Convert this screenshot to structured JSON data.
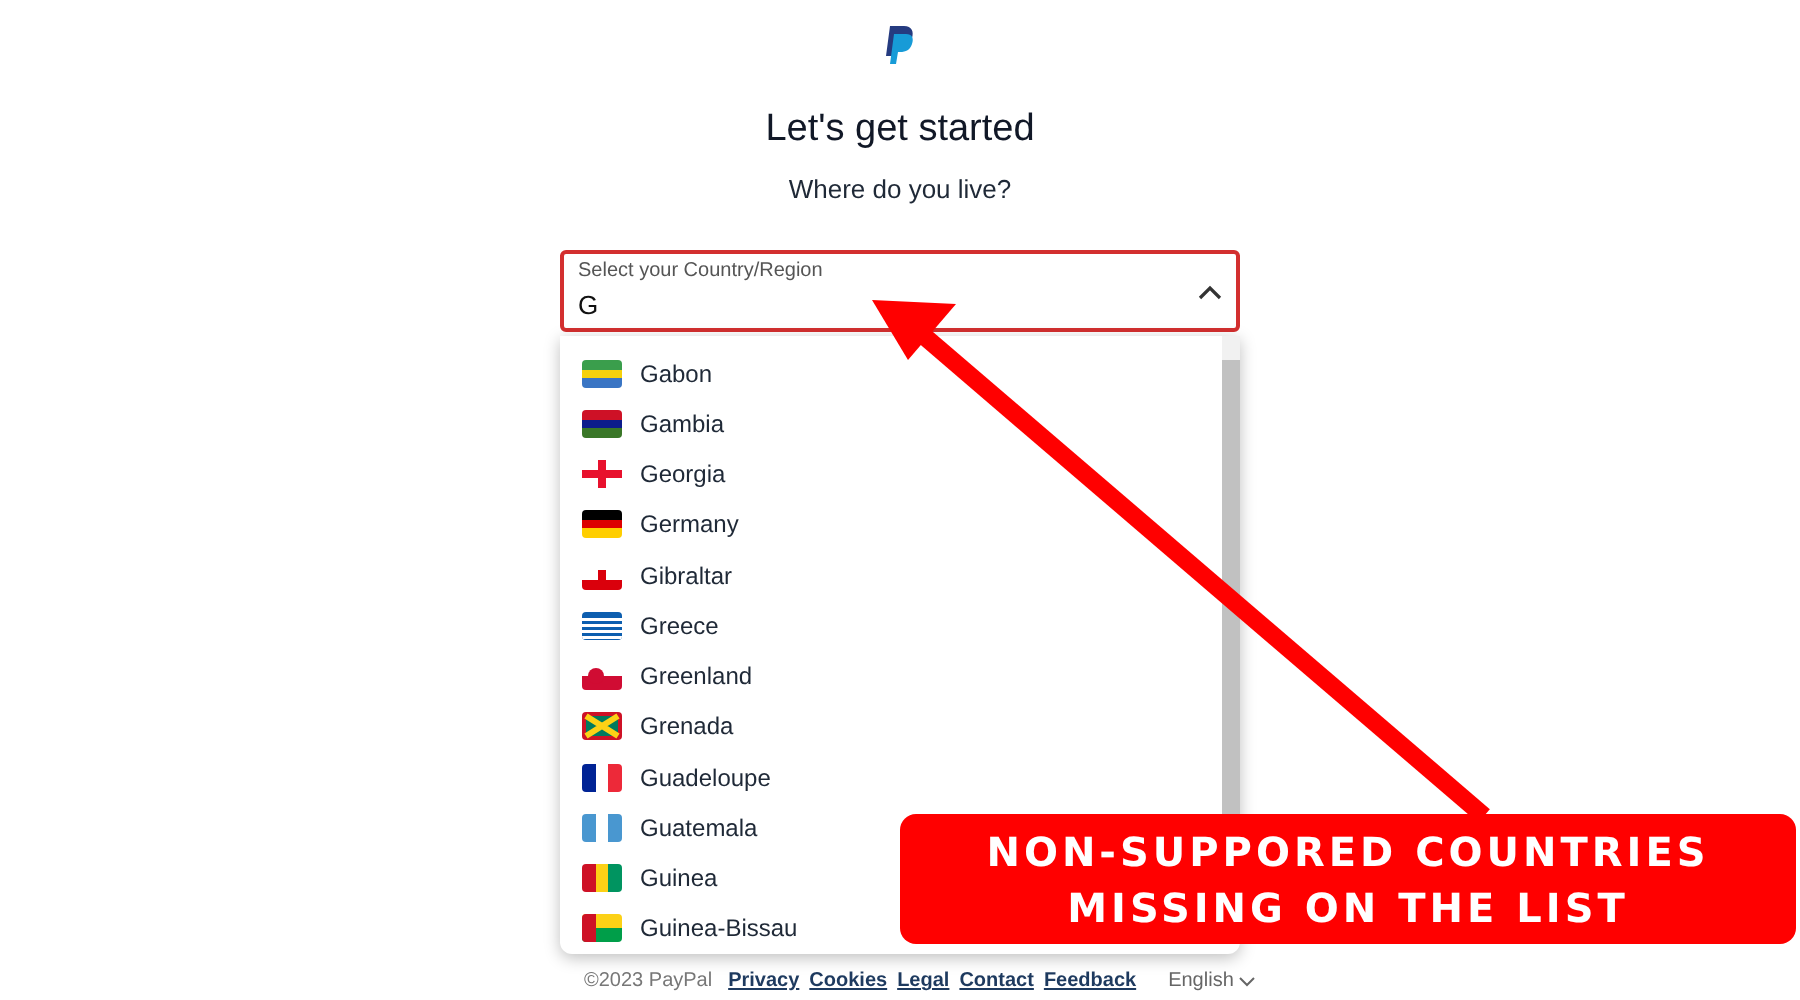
{
  "heading": "Let's get started",
  "subheading": "Where do you live?",
  "country_field": {
    "label": "Select your Country/Region",
    "value": "G",
    "expanded": true
  },
  "options": [
    {
      "label": "Gabon"
    },
    {
      "label": "Gambia"
    },
    {
      "label": "Georgia"
    },
    {
      "label": "Germany"
    },
    {
      "label": "Gibraltar"
    },
    {
      "label": "Greece"
    },
    {
      "label": "Greenland"
    },
    {
      "label": "Grenada"
    },
    {
      "label": "Guadeloupe"
    },
    {
      "label": "Guatemala"
    },
    {
      "label": "Guinea"
    },
    {
      "label": "Guinea-Bissau"
    }
  ],
  "footer": {
    "copyright": "©2023 PayPal",
    "links": [
      "Privacy",
      "Cookies",
      "Legal",
      "Contact",
      "Feedback"
    ],
    "language": "English"
  },
  "annotation": {
    "lines": [
      "NON-SUPPORED COUNTRIES",
      "MISSING ON THE LIST"
    ]
  }
}
